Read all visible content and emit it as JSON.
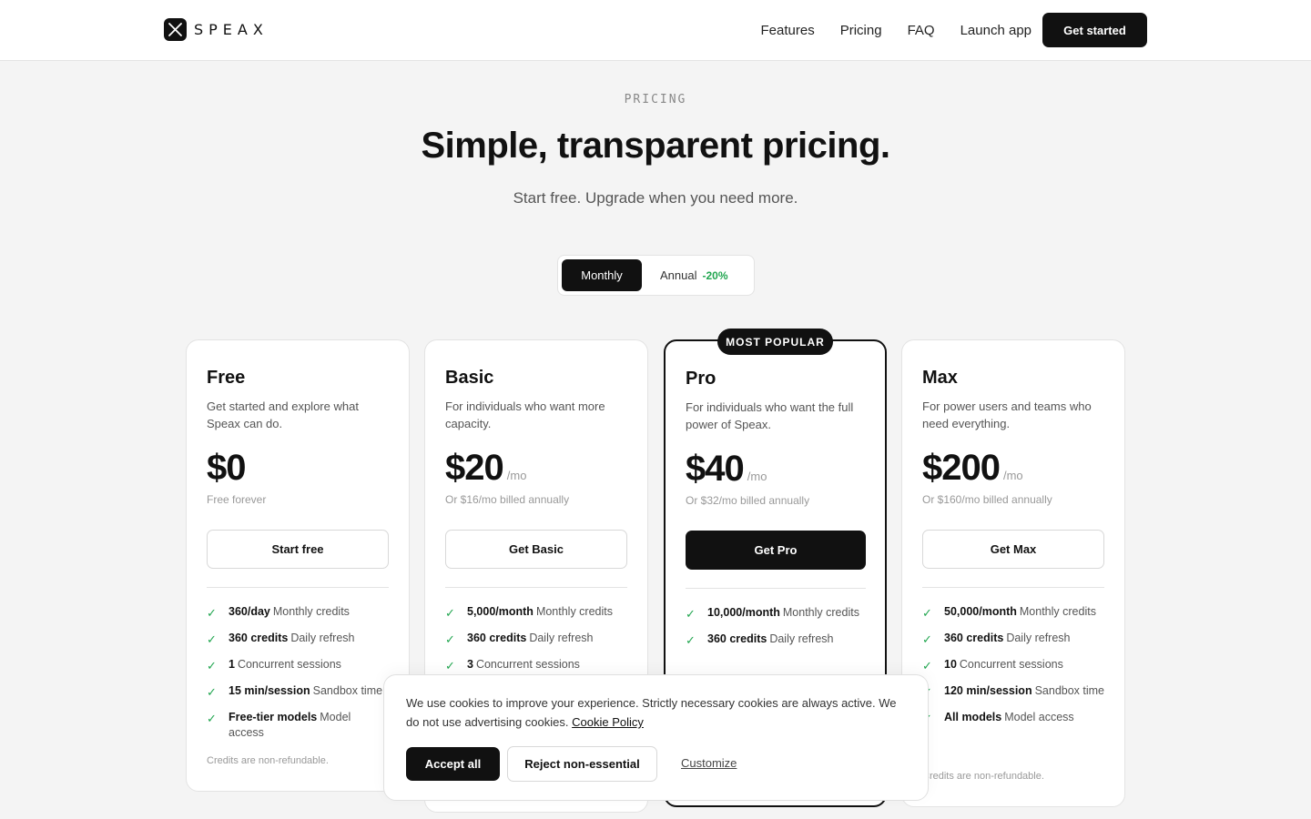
{
  "brand": {
    "name": "SPEAX"
  },
  "nav": {
    "links": [
      "Features",
      "Pricing",
      "FAQ",
      "Launch app"
    ],
    "cta": "Get started"
  },
  "hero": {
    "eyebrow": "PRICING",
    "title": "Simple, transparent pricing.",
    "subtitle": "Start free. Upgrade when you need more."
  },
  "billing_toggle": {
    "monthly": "Monthly",
    "annual": "Annual",
    "annual_badge": "-20%",
    "selected": "Monthly"
  },
  "popular_badge": "MOST POPULAR",
  "colors": {
    "accent": "#111111",
    "check": "#22a650",
    "background": "#f4f4f4"
  },
  "plans": [
    {
      "name": "Free",
      "description": "Get started and explore what Speax can do.",
      "price": "$0",
      "period": "",
      "note": "Free forever",
      "button": "Start free",
      "features": [
        {
          "value": "360/day",
          "label": "Monthly credits"
        },
        {
          "value": "360 credits",
          "label": "Daily refresh"
        },
        {
          "value": "1",
          "label": "Concurrent sessions"
        },
        {
          "value": "15 min/session",
          "label": "Sandbox time"
        },
        {
          "value": "Free-tier models",
          "label": "Model access"
        }
      ],
      "footnote": "Credits are non-refundable."
    },
    {
      "name": "Basic",
      "description": "For individuals who want more capacity.",
      "price": "$20",
      "period": "/mo",
      "note": "Or $16/mo billed annually",
      "button": "Get Basic",
      "features": [
        {
          "value": "5,000/month",
          "label": "Monthly credits"
        },
        {
          "value": "360 credits",
          "label": "Daily refresh"
        },
        {
          "value": "3",
          "label": "Concurrent sessions"
        }
      ]
    },
    {
      "name": "Pro",
      "description": "For individuals who want the full power of Speax.",
      "price": "$40",
      "period": "/mo",
      "note": "Or $32/mo billed annually",
      "button": "Get Pro",
      "features": [
        {
          "value": "10,000/month",
          "label": "Monthly credits"
        },
        {
          "value": "360 credits",
          "label": "Daily refresh"
        }
      ]
    },
    {
      "name": "Max",
      "description": "For power users and teams who need everything.",
      "price": "$200",
      "period": "/mo",
      "note": "Or $160/mo billed annually",
      "button": "Get Max",
      "features": [
        {
          "value": "50,000/month",
          "label": "Monthly credits"
        },
        {
          "value": "360 credits",
          "label": "Daily refresh"
        },
        {
          "value": "10",
          "label": "Concurrent sessions"
        },
        {
          "value": "120 min/session",
          "label": "Sandbox time"
        },
        {
          "value": "All models",
          "label": "Model access"
        }
      ],
      "footnote": "Credits are non-refundable."
    }
  ],
  "cookie_banner": {
    "text": "We use cookies to improve your experience. Strictly necessary cookies are always active. We do not use advertising cookies.",
    "link": "Cookie Policy",
    "accept": "Accept all",
    "reject": "Reject non-essential",
    "customize": "Customize"
  }
}
